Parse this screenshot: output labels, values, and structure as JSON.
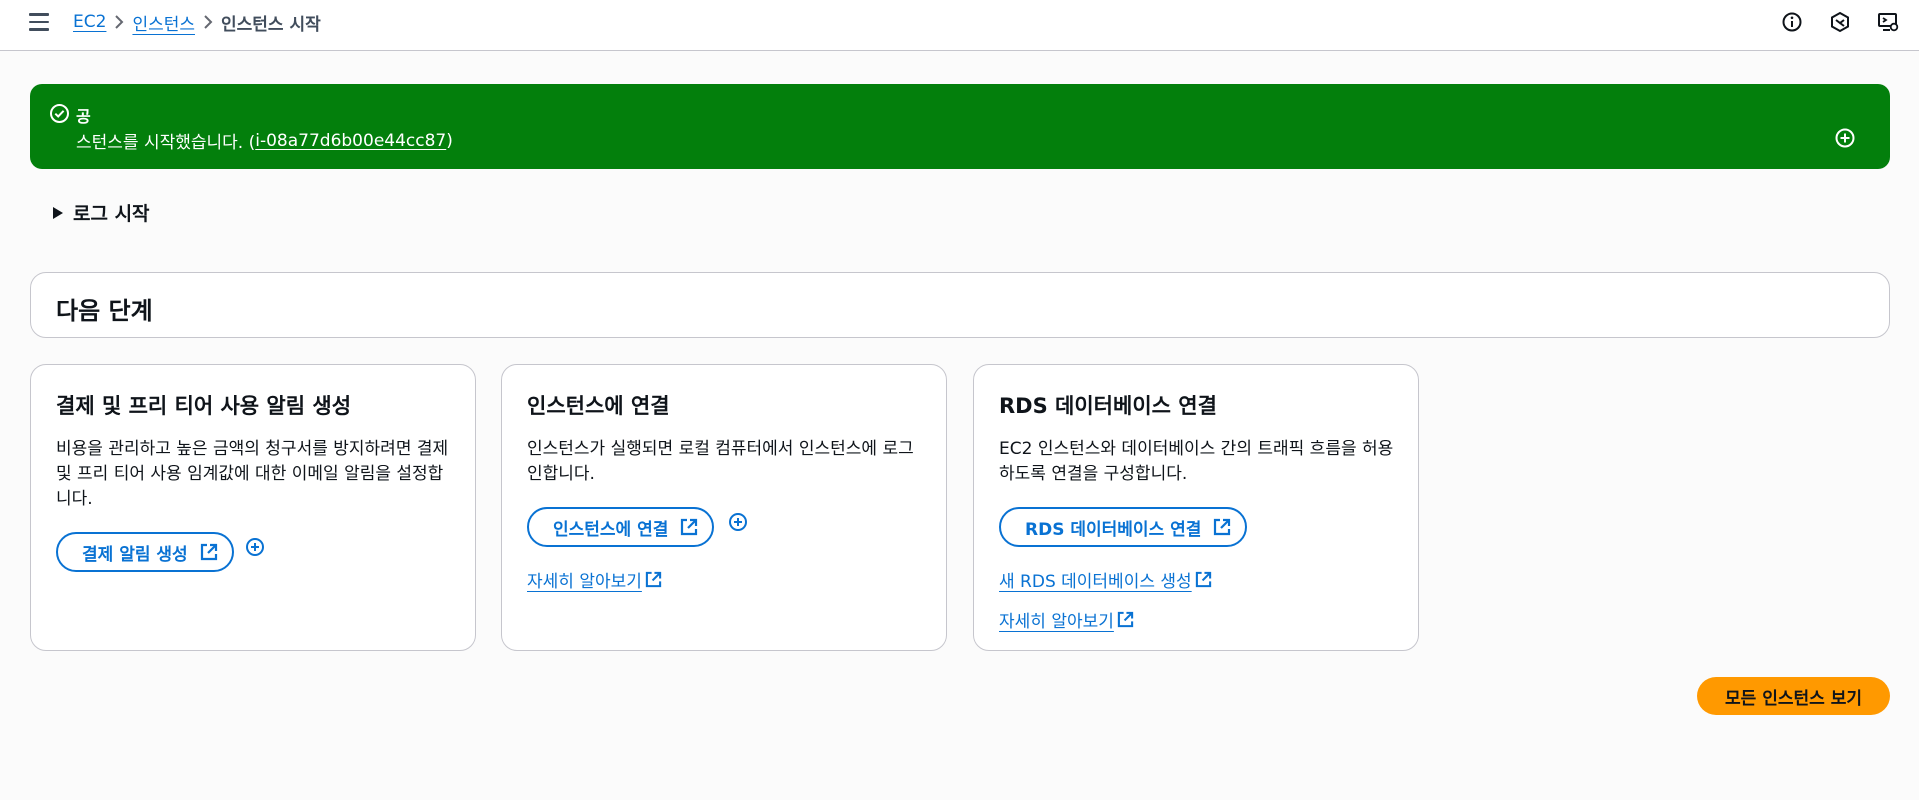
{
  "breadcrumb": {
    "items": [
      {
        "label": "EC2"
      },
      {
        "label": "인스턴스"
      }
    ],
    "current": "인스턴스 시작"
  },
  "top_icons": [
    "info-icon",
    "cloudshell-hexagon-icon",
    "display-settings-icon"
  ],
  "flash": {
    "type": "success",
    "color": "#037f0c",
    "title": "공",
    "message_prefix": "스턴스를 시작했습니다. (",
    "instance_id": "i-08a77d6b00e44cc87",
    "message_suffix": ")"
  },
  "log_section": {
    "label": "로그 시작",
    "expanded": false
  },
  "next_steps": {
    "title": "다음 단계"
  },
  "cards": [
    {
      "title": "결제 및 프리 티어 사용 알림 생성",
      "description": "비용을 관리하고 높은 금액의 청구서를 방지하려면 결제 및 프리 티어 사용 임계값에 대한 이메일 알림을 설정합니다.",
      "button": "결제 알림 생성"
    },
    {
      "title": "인스턴스에 연결",
      "description": "인스턴스가 실행되면 로컬 컴퓨터에서 인스턴스에 로그인합니다.",
      "button": "인스턴스에 연결",
      "links": [
        "자세히 알아보기"
      ]
    },
    {
      "title": "RDS 데이터베이스 연결",
      "description": "EC2 인스턴스와 데이터베이스 간의 트래픽 흐름을 허용하도록 연결을 구성합니다.",
      "button": "RDS 데이터베이스 연결",
      "links": [
        "새 RDS 데이터베이스 생성",
        "자세히 알아보기"
      ]
    }
  ],
  "primary_action": {
    "label": "모든 인스턴스 보기",
    "color": "#ff9900"
  },
  "colors": {
    "link": "#0972d3",
    "text": "#0f141a",
    "border": "#c6c6cd"
  }
}
